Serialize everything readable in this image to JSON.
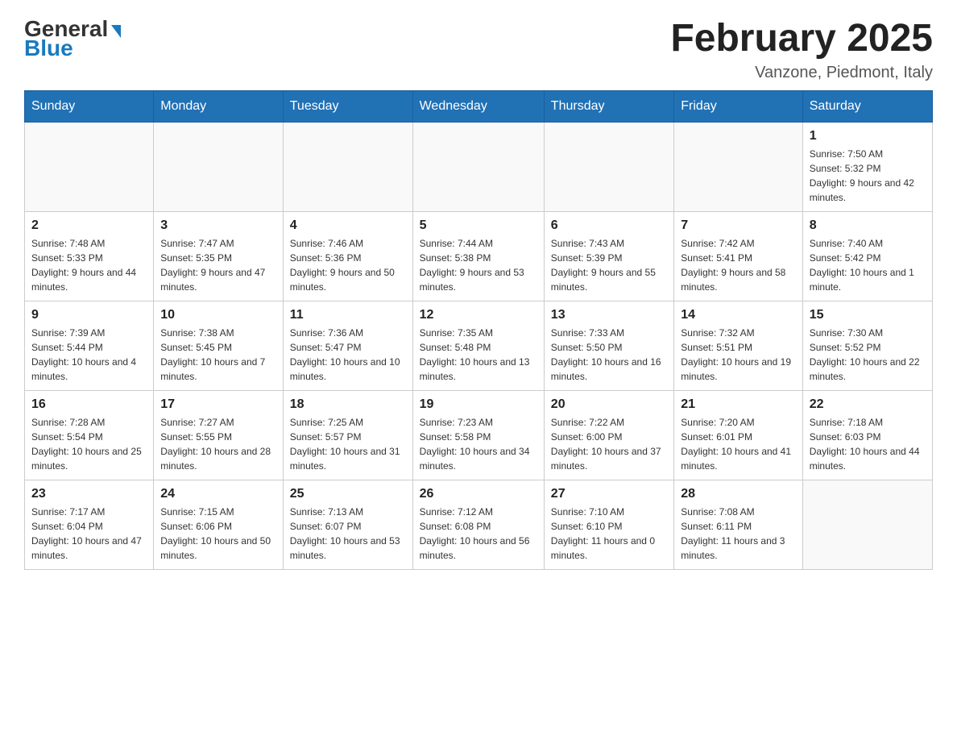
{
  "header": {
    "logo_general": "General",
    "logo_blue": "Blue",
    "month_year": "February 2025",
    "location": "Vanzone, Piedmont, Italy"
  },
  "weekdays": [
    "Sunday",
    "Monday",
    "Tuesday",
    "Wednesday",
    "Thursday",
    "Friday",
    "Saturday"
  ],
  "weeks": [
    {
      "days": [
        {
          "num": "",
          "info": ""
        },
        {
          "num": "",
          "info": ""
        },
        {
          "num": "",
          "info": ""
        },
        {
          "num": "",
          "info": ""
        },
        {
          "num": "",
          "info": ""
        },
        {
          "num": "",
          "info": ""
        },
        {
          "num": "1",
          "info": "Sunrise: 7:50 AM\nSunset: 5:32 PM\nDaylight: 9 hours and 42 minutes."
        }
      ]
    },
    {
      "days": [
        {
          "num": "2",
          "info": "Sunrise: 7:48 AM\nSunset: 5:33 PM\nDaylight: 9 hours and 44 minutes."
        },
        {
          "num": "3",
          "info": "Sunrise: 7:47 AM\nSunset: 5:35 PM\nDaylight: 9 hours and 47 minutes."
        },
        {
          "num": "4",
          "info": "Sunrise: 7:46 AM\nSunset: 5:36 PM\nDaylight: 9 hours and 50 minutes."
        },
        {
          "num": "5",
          "info": "Sunrise: 7:44 AM\nSunset: 5:38 PM\nDaylight: 9 hours and 53 minutes."
        },
        {
          "num": "6",
          "info": "Sunrise: 7:43 AM\nSunset: 5:39 PM\nDaylight: 9 hours and 55 minutes."
        },
        {
          "num": "7",
          "info": "Sunrise: 7:42 AM\nSunset: 5:41 PM\nDaylight: 9 hours and 58 minutes."
        },
        {
          "num": "8",
          "info": "Sunrise: 7:40 AM\nSunset: 5:42 PM\nDaylight: 10 hours and 1 minute."
        }
      ]
    },
    {
      "days": [
        {
          "num": "9",
          "info": "Sunrise: 7:39 AM\nSunset: 5:44 PM\nDaylight: 10 hours and 4 minutes."
        },
        {
          "num": "10",
          "info": "Sunrise: 7:38 AM\nSunset: 5:45 PM\nDaylight: 10 hours and 7 minutes."
        },
        {
          "num": "11",
          "info": "Sunrise: 7:36 AM\nSunset: 5:47 PM\nDaylight: 10 hours and 10 minutes."
        },
        {
          "num": "12",
          "info": "Sunrise: 7:35 AM\nSunset: 5:48 PM\nDaylight: 10 hours and 13 minutes."
        },
        {
          "num": "13",
          "info": "Sunrise: 7:33 AM\nSunset: 5:50 PM\nDaylight: 10 hours and 16 minutes."
        },
        {
          "num": "14",
          "info": "Sunrise: 7:32 AM\nSunset: 5:51 PM\nDaylight: 10 hours and 19 minutes."
        },
        {
          "num": "15",
          "info": "Sunrise: 7:30 AM\nSunset: 5:52 PM\nDaylight: 10 hours and 22 minutes."
        }
      ]
    },
    {
      "days": [
        {
          "num": "16",
          "info": "Sunrise: 7:28 AM\nSunset: 5:54 PM\nDaylight: 10 hours and 25 minutes."
        },
        {
          "num": "17",
          "info": "Sunrise: 7:27 AM\nSunset: 5:55 PM\nDaylight: 10 hours and 28 minutes."
        },
        {
          "num": "18",
          "info": "Sunrise: 7:25 AM\nSunset: 5:57 PM\nDaylight: 10 hours and 31 minutes."
        },
        {
          "num": "19",
          "info": "Sunrise: 7:23 AM\nSunset: 5:58 PM\nDaylight: 10 hours and 34 minutes."
        },
        {
          "num": "20",
          "info": "Sunrise: 7:22 AM\nSunset: 6:00 PM\nDaylight: 10 hours and 37 minutes."
        },
        {
          "num": "21",
          "info": "Sunrise: 7:20 AM\nSunset: 6:01 PM\nDaylight: 10 hours and 41 minutes."
        },
        {
          "num": "22",
          "info": "Sunrise: 7:18 AM\nSunset: 6:03 PM\nDaylight: 10 hours and 44 minutes."
        }
      ]
    },
    {
      "days": [
        {
          "num": "23",
          "info": "Sunrise: 7:17 AM\nSunset: 6:04 PM\nDaylight: 10 hours and 47 minutes."
        },
        {
          "num": "24",
          "info": "Sunrise: 7:15 AM\nSunset: 6:06 PM\nDaylight: 10 hours and 50 minutes."
        },
        {
          "num": "25",
          "info": "Sunrise: 7:13 AM\nSunset: 6:07 PM\nDaylight: 10 hours and 53 minutes."
        },
        {
          "num": "26",
          "info": "Sunrise: 7:12 AM\nSunset: 6:08 PM\nDaylight: 10 hours and 56 minutes."
        },
        {
          "num": "27",
          "info": "Sunrise: 7:10 AM\nSunset: 6:10 PM\nDaylight: 11 hours and 0 minutes."
        },
        {
          "num": "28",
          "info": "Sunrise: 7:08 AM\nSunset: 6:11 PM\nDaylight: 11 hours and 3 minutes."
        },
        {
          "num": "",
          "info": ""
        }
      ]
    }
  ]
}
